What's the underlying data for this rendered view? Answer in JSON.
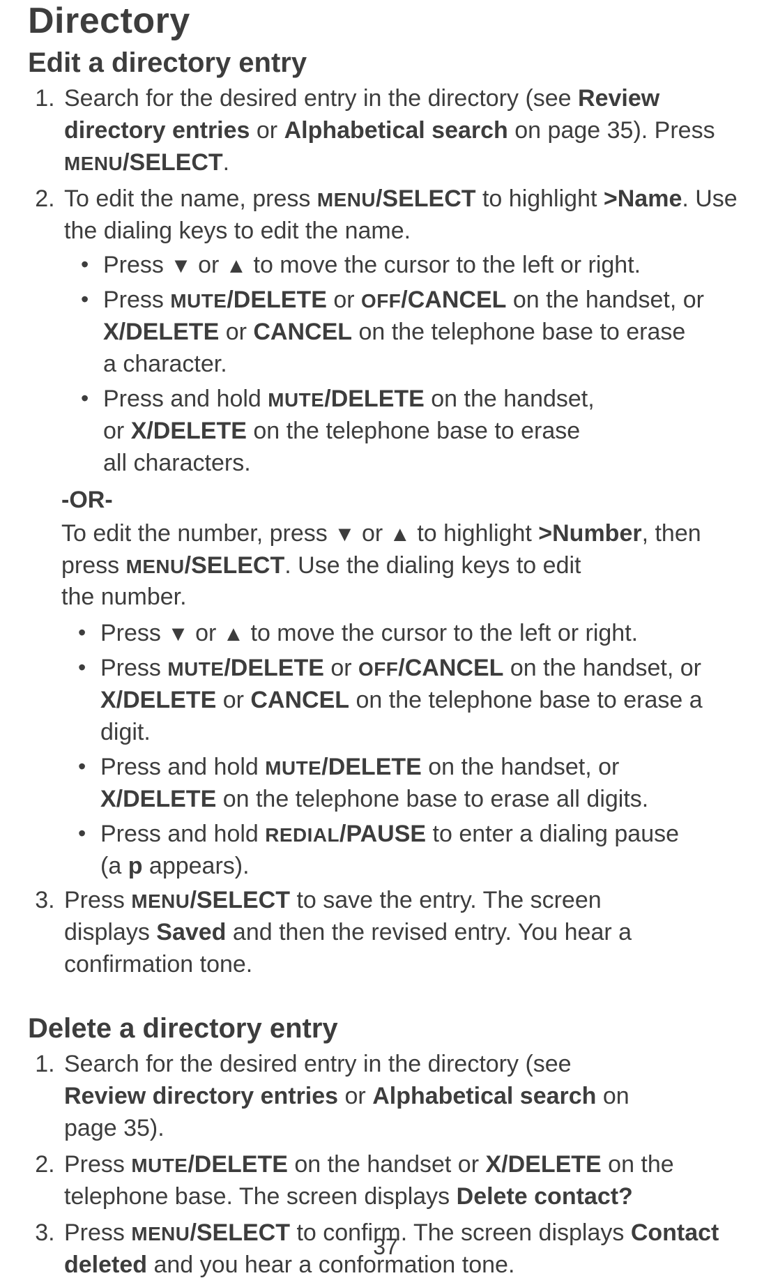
{
  "title": "Directory",
  "page_number": "37",
  "edit": {
    "heading": "Edit a directory entry",
    "step1": {
      "t1": "Search for the desired entry in the directory (see ",
      "b1": "Review directory entries",
      "t2": " or ",
      "b2": "Alphabetical search",
      "t3": " on page 35). Press ",
      "sc": "MENU",
      "b3": "/SELECT",
      "t4": "."
    },
    "step2": {
      "t1": "To edit the name, press ",
      "sc": "MENU",
      "b1": "/SELECT",
      "t2": " to highlight ",
      "b2": ">Name",
      "t3": ". Use the dialing keys to edit the name."
    },
    "name_bullets": {
      "b1": {
        "t1": "Press ",
        "down": "▼",
        "t2": " or ",
        "up": "▲",
        "t3": " to move the cursor to the left or right."
      },
      "b2": {
        "t1": "Press ",
        "sc1": "MUTE",
        "b1": "/DELETE",
        "t2": " or ",
        "sc2": "OFF",
        "b2": "/CANCEL",
        "t3": " on the handset, or ",
        "b3": "X/DELETE",
        "t4": " or ",
        "b4": "CANCEL",
        "t5": " on the telephone base to erase",
        "line2": "a character."
      },
      "b3": {
        "t1": "Press and hold ",
        "sc1": "MUTE",
        "b1": "/DELETE",
        "t2": " on the handset,",
        "line2a": "or ",
        "b_line2": "X/DELETE",
        "line2b": " on the telephone base to erase",
        "line3": "all characters."
      }
    },
    "or_label": "-OR-",
    "or_text": {
      "t1": "To edit the number, press ",
      "down": "▼",
      "t2": " or ",
      "up": "▲",
      "t3": " to highlight ",
      "b1": ">Number",
      "t4": ", then press ",
      "sc": "MENU",
      "b2": "/ SELECT",
      "sc_sel": "/",
      "b_sel": "SELECT",
      "t5": ". Use the dialing keys to edit",
      "line2": "the number."
    },
    "num_bullets": {
      "b1": {
        "t1": "Press ",
        "down": "▼",
        "t2": " or ",
        "up": "▲",
        "t3": " to move the cursor to the left or right."
      },
      "b2": {
        "t1": "Press ",
        "sc1": "MUTE",
        "b1": "/DELETE",
        "t2": " or ",
        "sc2": "OFF",
        "b2": "/CANCEL",
        "t3": " on the handset, or ",
        "b3": "X/DELETE",
        "t4": " or ",
        "b4": "CANCEL",
        "t5": " on the telephone base to erase a digit."
      },
      "b3": {
        "t1": "Press and hold ",
        "sc1": "MUTE",
        "b1": "/DELETE",
        "t2": " on the handset, or",
        "line2a": "",
        "b_line2": "X/DELETE",
        "line2b": " on the telephone base to erase all digits."
      },
      "b4": {
        "t1": "Press and hold ",
        "sc1": "REDIAL",
        "b1": "/PAUSE",
        "t2": " to enter a dialing pause",
        "line2a": "(a ",
        "b2": "p",
        "line2b": " appears)."
      }
    },
    "step3": {
      "t1": "Press ",
      "sc": "MENU",
      "b1": "/SELECT",
      "t2": " to save the entry. The screen",
      "line2a": "displays ",
      "b2": "Saved",
      "line2b": " and then the revised entry. You hear a",
      "line3": "confirmation tone."
    }
  },
  "delete": {
    "heading": "Delete a directory entry",
    "step1": {
      "t1": "Search for the desired entry in the directory (see",
      "line2a": "",
      "b1": "Review directory entries",
      "t2": " or ",
      "b2": "Alphabetical search",
      "t3": " on",
      "line3": "page 35)."
    },
    "step2": {
      "t1": "Press ",
      "sc": "MUTE",
      "b1": "/DELETE",
      "t2": " on the handset or ",
      "b2": "X/DELETE",
      "t3": " on the telephone base. The screen displays ",
      "b3": "Delete contact?"
    },
    "step3": {
      "t1": "Press ",
      "sc": "MENU",
      "b1": "/SELECT",
      "t2": " to confirm. The screen displays ",
      "b2": "Contact deleted",
      "t3": " and you hear a conformation tone."
    }
  }
}
